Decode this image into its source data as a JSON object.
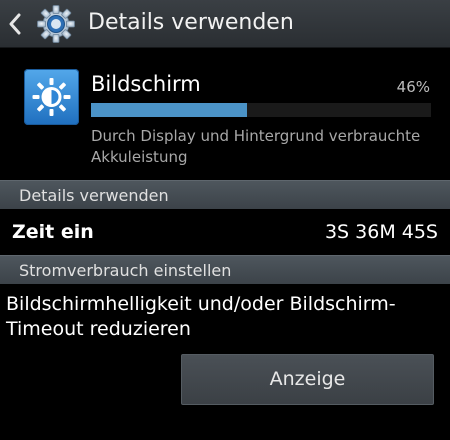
{
  "actionbar": {
    "title": "Details verwenden",
    "back_icon": "chevron-left-icon",
    "app_icon": "settings-gear-icon"
  },
  "item": {
    "icon": "brightness-sun-icon",
    "title": "Bildschirm",
    "percent_label": "46%",
    "usage_fraction": 0.46,
    "description": "Durch Display und Hintergrund verbrauchte Akkuleistung"
  },
  "details_section": {
    "header": "Details verwenden",
    "rows": [
      {
        "label": "Zeit ein",
        "value": "3S 36M 45S"
      }
    ]
  },
  "power_section": {
    "header": "Stromverbrauch einstellen",
    "suggestion": "Bildschirmhelligkeit und/oder Bildschirm-Timeout reduzieren",
    "button_label": "Anzeige"
  },
  "colors": {
    "progress_fill": "#4b93c7",
    "icon_blue": "#2f86d6",
    "section_header": "#464d53"
  }
}
